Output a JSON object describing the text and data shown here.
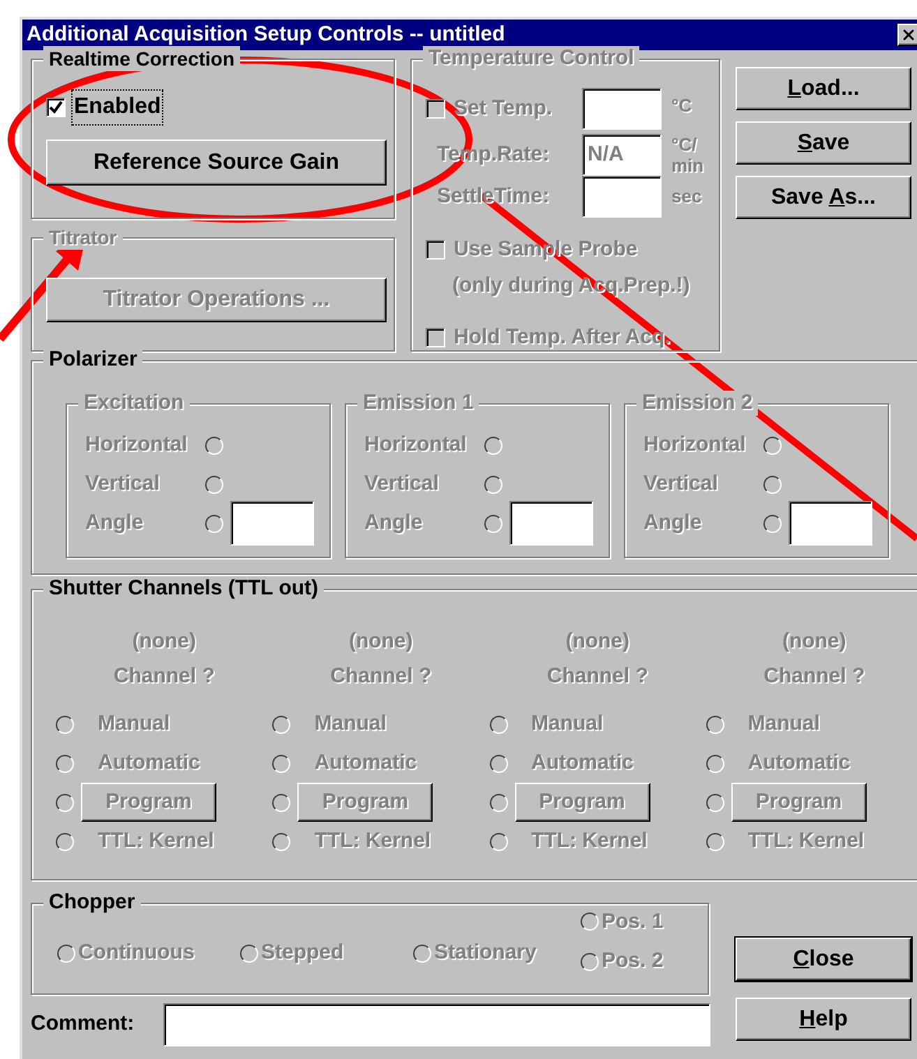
{
  "window": {
    "title": "Additional Acquisition Setup Controls -- untitled"
  },
  "realtime_correction": {
    "title": "Realtime Correction",
    "disabled": false,
    "enabled": {
      "label": "Enabled",
      "checked": true
    },
    "button": "Reference Source Gain"
  },
  "titrator": {
    "title": "Titrator",
    "disabled": true,
    "button": "Titrator Operations ..."
  },
  "temperature_control": {
    "title": "Temperature Control",
    "disabled": true,
    "set_temp": {
      "label": "Set Temp.",
      "checked": false,
      "unit": "°C"
    },
    "temp_rate": {
      "label": "Temp.Rate:",
      "value": "N/A",
      "unit_top": "°C/",
      "unit_bottom": "min"
    },
    "settle_time": {
      "label": "SettleTime:",
      "unit": "sec"
    },
    "use_sample_probe": {
      "label": "Use Sample Probe",
      "note": "(only during Acq.Prep.!)",
      "checked": false
    },
    "hold_temp": {
      "label": "Hold Temp. After Acq.",
      "checked": false
    }
  },
  "side_buttons": [
    {
      "hotkey": "L",
      "after": "oad..."
    },
    {
      "hotkey": "S",
      "after": "ave"
    },
    {
      "before": "Save ",
      "hotkey": "A",
      "after": "s..."
    }
  ],
  "polarizer": {
    "title": "Polarizer",
    "groups": [
      {
        "title": "Excitation",
        "disabled": true,
        "rows": [
          {
            "kind": "radio",
            "label": "Horizontal",
            "selected": false
          },
          {
            "kind": "radio",
            "label": "Vertical",
            "selected": false
          },
          {
            "kind": "radio_field",
            "label": "Angle",
            "selected": false
          }
        ]
      },
      {
        "title": "Emission 1",
        "disabled": true,
        "rows": [
          {
            "kind": "radio",
            "label": "Horizontal",
            "selected": false
          },
          {
            "kind": "radio",
            "label": "Vertical",
            "selected": false
          },
          {
            "kind": "radio_field",
            "label": "Angle",
            "selected": false
          }
        ]
      },
      {
        "title": "Emission 2",
        "disabled": true,
        "rows": [
          {
            "kind": "radio",
            "label": "Horizontal",
            "selected": false
          },
          {
            "kind": "radio",
            "label": "Vertical",
            "selected": false
          },
          {
            "kind": "radio_field",
            "label": "Angle",
            "selected": false
          }
        ]
      }
    ]
  },
  "shutter_channels": {
    "title": "Shutter Channels (TTL out)",
    "channels": [
      {
        "name": "(none)",
        "channel": "Channel ?",
        "disabled": true,
        "options": [
          {
            "kind": "text",
            "label": "Manual",
            "selected": false
          },
          {
            "kind": "text",
            "label": "Automatic",
            "selected": false
          },
          {
            "kind": "button",
            "label": "Program",
            "selected": false
          },
          {
            "kind": "text",
            "label": "TTL: Kernel",
            "selected": false
          }
        ]
      },
      {
        "name": "(none)",
        "channel": "Channel ?",
        "disabled": true,
        "options": [
          {
            "kind": "text",
            "label": "Manual",
            "selected": false
          },
          {
            "kind": "text",
            "label": "Automatic",
            "selected": false
          },
          {
            "kind": "button",
            "label": "Program",
            "selected": false
          },
          {
            "kind": "text",
            "label": "TTL: Kernel",
            "selected": false
          }
        ]
      },
      {
        "name": "(none)",
        "channel": "Channel ?",
        "disabled": true,
        "options": [
          {
            "kind": "text",
            "label": "Manual",
            "selected": false
          },
          {
            "kind": "text",
            "label": "Automatic",
            "selected": false
          },
          {
            "kind": "button",
            "label": "Program",
            "selected": false
          },
          {
            "kind": "text",
            "label": "TTL: Kernel",
            "selected": false
          }
        ]
      },
      {
        "name": "(none)",
        "channel": "Channel ?",
        "disabled": true,
        "options": [
          {
            "kind": "text",
            "label": "Manual",
            "selected": false
          },
          {
            "kind": "text",
            "label": "Automatic",
            "selected": false
          },
          {
            "kind": "button",
            "label": "Program",
            "selected": false
          },
          {
            "kind": "text",
            "label": "TTL: Kernel",
            "selected": false
          }
        ]
      }
    ]
  },
  "chopper": {
    "title": "Chopper",
    "options": [
      {
        "label": "Continuous",
        "selected": false,
        "disabled": true
      },
      {
        "label": "Stepped",
        "selected": false,
        "disabled": true
      },
      {
        "label": "Stationary",
        "selected": false,
        "disabled": true
      }
    ],
    "positions": [
      {
        "label": "Pos. 1",
        "selected": false,
        "disabled": true
      },
      {
        "label": "Pos. 2",
        "selected": false,
        "disabled": true
      }
    ]
  },
  "bottom_buttons": [
    {
      "hotkey": "C",
      "after": "lose",
      "default": true
    },
    {
      "hotkey": "H",
      "after": "elp",
      "default": false
    }
  ],
  "comment": {
    "label": "Comment:"
  }
}
